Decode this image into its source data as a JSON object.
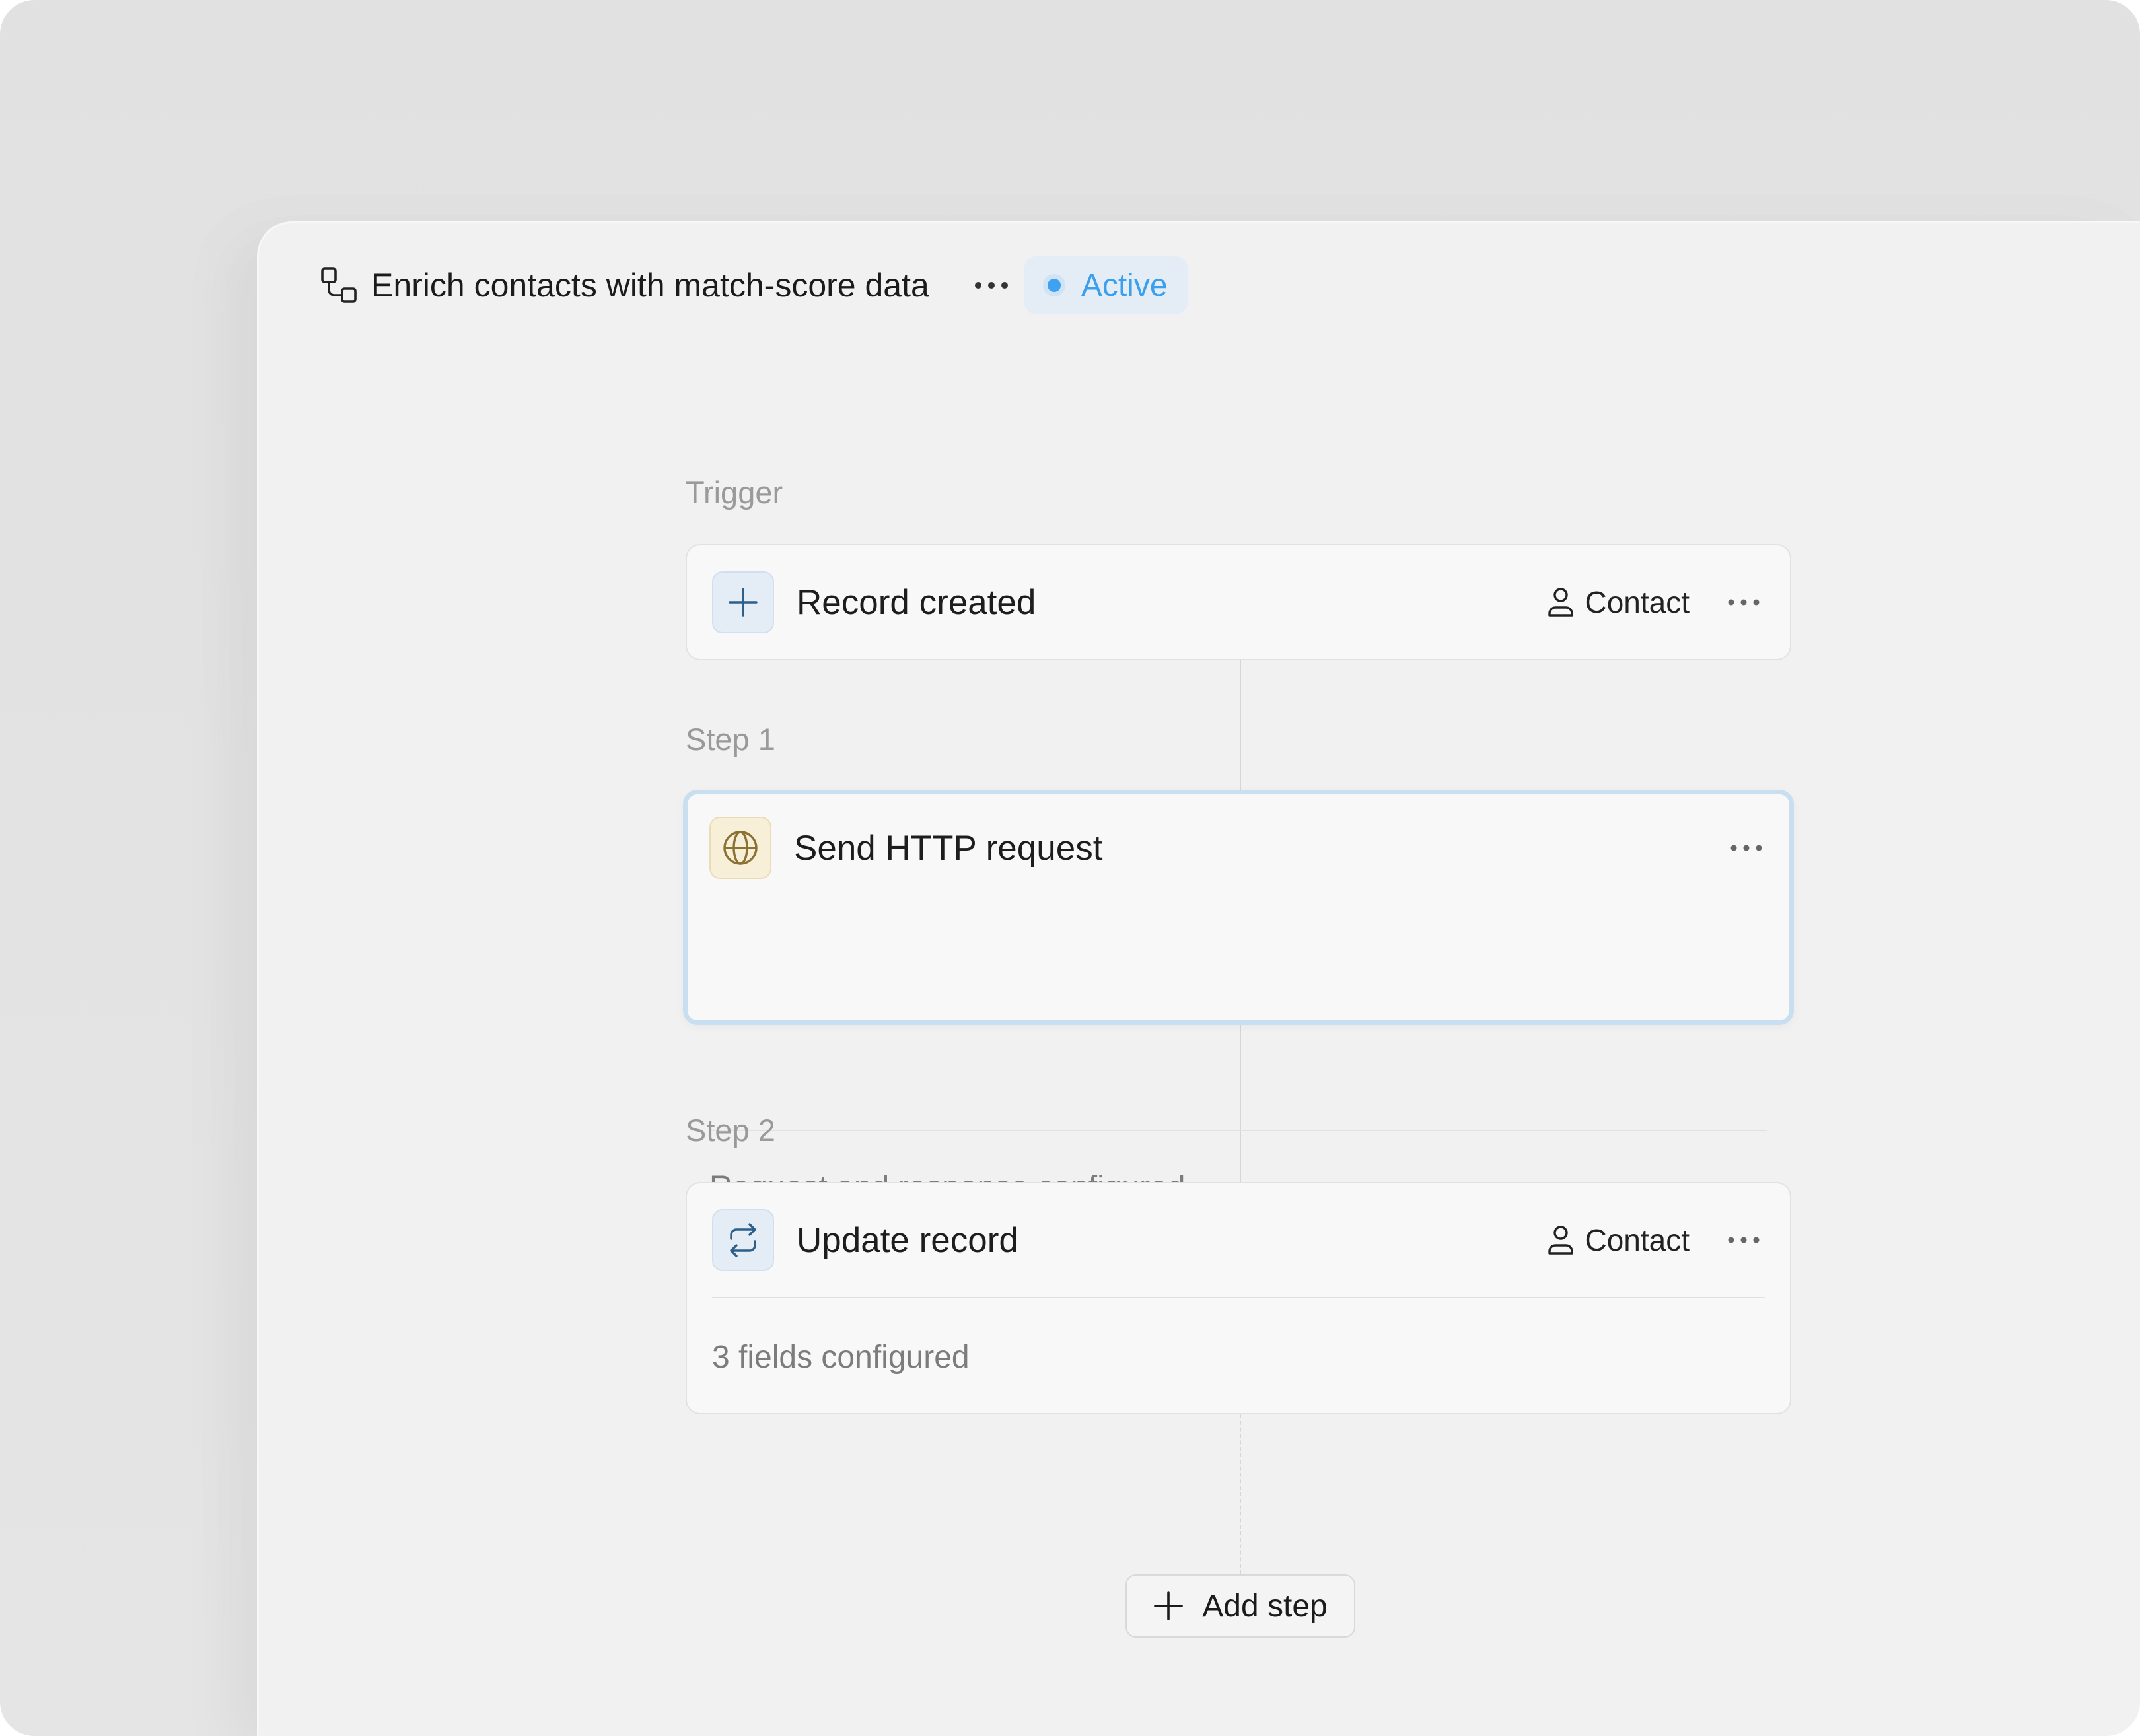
{
  "workflow": {
    "title": "Enrich contacts with match-score data",
    "status": "Active",
    "status_color": "#3ea2f1"
  },
  "trigger": {
    "section_label": "Trigger",
    "title": "Record created",
    "icon": "plus-icon",
    "object": "Contact",
    "object_icon": "person-icon"
  },
  "steps": [
    {
      "section_label": "Step 1",
      "title": "Send HTTP request",
      "icon": "globe-icon",
      "description": "Request and response configured",
      "selected": true
    },
    {
      "section_label": "Step 2",
      "title": "Update record",
      "icon": "refresh-icon",
      "object": "Contact",
      "object_icon": "person-icon",
      "description": "3 fields configured"
    }
  ],
  "add_step": {
    "label": "Add step",
    "icon": "plus-icon"
  },
  "colors": {
    "accent": "#3aa0ee",
    "selected_border": "#c8dff1",
    "icon_blue": "#2d5f88",
    "icon_gold": "#8a7232"
  }
}
